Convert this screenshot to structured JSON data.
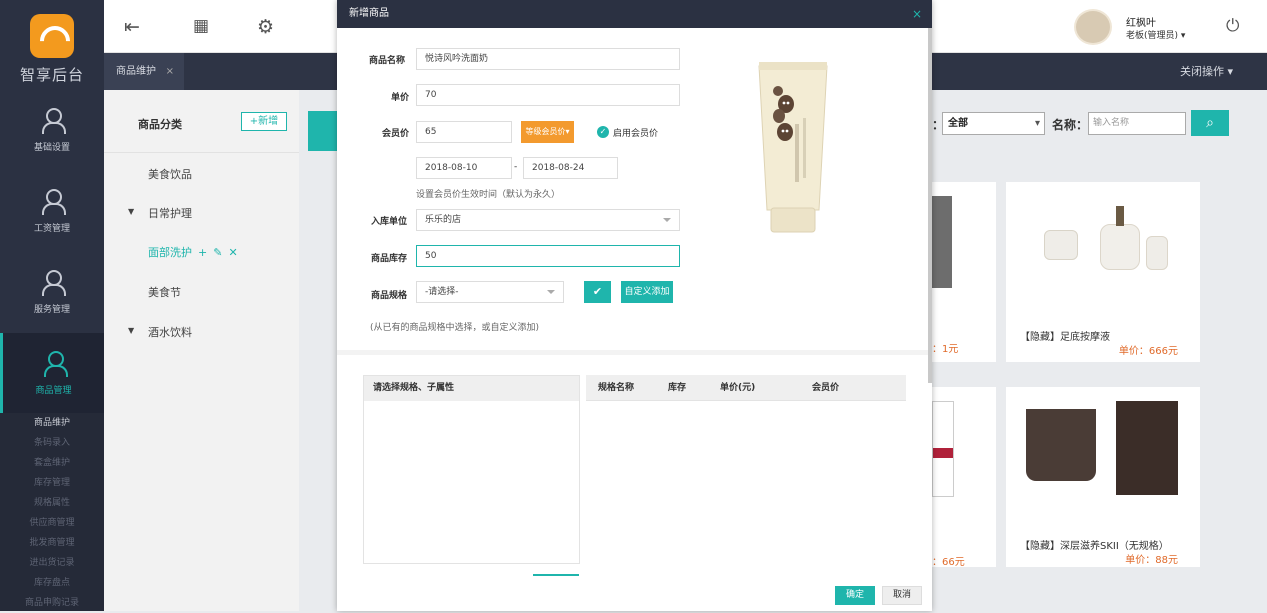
{
  "sidebar": {
    "logo_text": "智享后台",
    "nav": [
      {
        "label": "基础设置",
        "icon": "user-icon"
      },
      {
        "label": "工资管理",
        "icon": "user-icon"
      },
      {
        "label": "服务管理",
        "icon": "user-icon"
      },
      {
        "label": "商品管理",
        "icon": "user-icon"
      }
    ],
    "subnav": [
      "商品维护",
      "条码录入",
      "套盒维护",
      "库存管理",
      "规格属性",
      "供应商管理",
      "批发商管理",
      "进出货记录",
      "库存盘点",
      "商品申购记录"
    ]
  },
  "topbar": {
    "user_name": "红枫叶",
    "user_role": "老板(管理员)",
    "tab_label": "商品维护",
    "tab_close": "×",
    "close_ops": "关闭操作"
  },
  "category": {
    "title": "商品分类",
    "add_label": "+新增",
    "items": [
      {
        "label": "美食饮品"
      },
      {
        "label": "日常护理"
      },
      {
        "label": "面部洗护"
      },
      {
        "label": "美食节"
      },
      {
        "label": "酒水饮料"
      }
    ],
    "caret": "▼"
  },
  "filter": {
    "status_value": "全部",
    "name_label": "名称：",
    "colon": "：",
    "name_placeholder": "输入名称"
  },
  "products": [
    {
      "name": "",
      "price": "：1元"
    },
    {
      "name": "【隐藏】足底按摩液",
      "price": "单价：666元"
    },
    {
      "name": "",
      "price": "：66元"
    },
    {
      "name": "【隐藏】深层滋养SKII（无规格）",
      "price": "单价：88元"
    }
  ],
  "modal": {
    "title": "新增商品",
    "close": "×",
    "name_label": "商品名称",
    "name_value": "悦诗风吟洗面奶",
    "price_label": "单价",
    "price_value": "70",
    "member_label": "会员价",
    "member_value": "65",
    "level_btn": "等级会员价",
    "enable_member": "启用会员价",
    "date_start": "2018-08-10",
    "date_sep": "-",
    "date_end": "2018-08-24",
    "date_hint": "设置会员价生效时间（默认为永久）",
    "unit_label": "入库单位",
    "unit_value": "乐乐的店",
    "stock_label": "商品库存",
    "stock_value": "50",
    "spec_label": "商品规格",
    "spec_value": "-请选择-",
    "custom_add": "自定义添加",
    "spec_hint": "(从已有的商品规格中选择，或自定义添加)",
    "left_header": "请选择规格、子属性",
    "right_headers": [
      "规格名称",
      "库存",
      "单价(元)",
      "会员价"
    ],
    "confirm": "确定",
    "cancel": "取消"
  }
}
